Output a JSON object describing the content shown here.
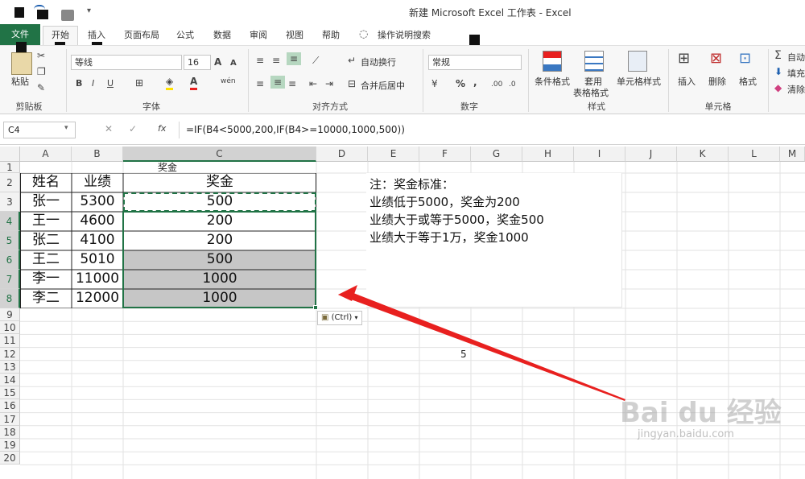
{
  "window": {
    "title": "新建 Microsoft Excel 工作表  -  Excel"
  },
  "tabs": [
    {
      "label": "文件"
    },
    {
      "label": "开始"
    },
    {
      "label": "插入"
    },
    {
      "label": "页面布局"
    },
    {
      "label": "公式"
    },
    {
      "label": "数据"
    },
    {
      "label": "审阅"
    },
    {
      "label": "视图"
    },
    {
      "label": "帮助"
    }
  ],
  "tell_me": {
    "label": "操作说明搜索"
  },
  "ribbon": {
    "clipboard": {
      "paste": "粘贴",
      "label": "剪贴板"
    },
    "font": {
      "name": "等线",
      "size": "16",
      "label": "字体",
      "bold": "B",
      "italic": "I",
      "underline": "U",
      "phonetic": "wén"
    },
    "align": {
      "wrap": "自动换行",
      "merge": "合并后居中",
      "label": "对齐方式"
    },
    "number": {
      "format": "常规",
      "label": "数字",
      "percent": "%",
      "comma": ","
    },
    "styles": {
      "conditional": "条件格式",
      "table_l1": "套用",
      "table_l2": "表格格式",
      "cell_styles": "单元格样式",
      "label": "样式"
    },
    "cells": {
      "insert": "插入",
      "delete": "删除",
      "format": "格式",
      "label": "单元格"
    },
    "editing": {
      "autosum": "自动",
      "fill": "填充",
      "clear": "清除"
    }
  },
  "formula_bar": {
    "name_box": "C4",
    "fx": "fx",
    "formula": "=IF(B4<5000,200,IF(B4>=10000,1000,500))"
  },
  "columns": [
    "A",
    "B",
    "C",
    "D",
    "E",
    "F",
    "G",
    "H",
    "I",
    "J",
    "K",
    "L",
    "M"
  ],
  "rows": [
    "1",
    "2",
    "3",
    "4",
    "5",
    "6",
    "7",
    "8",
    "9",
    "10",
    "11",
    "12",
    "13",
    "14",
    "15",
    "16",
    "17",
    "18",
    "19",
    "20"
  ],
  "table": {
    "merged_title": "奖金",
    "headers": [
      "姓名",
      "业绩",
      "奖金"
    ],
    "rows": [
      [
        "张一",
        "5300",
        "500"
      ],
      [
        "王一",
        "4600",
        "200"
      ],
      [
        "张二",
        "4100",
        "200"
      ],
      [
        "王二",
        "5010",
        "500"
      ],
      [
        "李一",
        "11000",
        "1000"
      ],
      [
        "李二",
        "12000",
        "1000"
      ]
    ]
  },
  "notes": [
    "注：奖金标准：",
    "业绩低于5000，奖金为200",
    "业绩大于或等于5000，奖金500",
    "业绩大于等于1万，奖金1000"
  ],
  "stray_value": "5",
  "paste_options": {
    "label": "(Ctrl)"
  },
  "watermark": {
    "brand": "Bai du 经验",
    "url": "jingyan.baidu.com"
  },
  "colors": {
    "excel_green": "#217346",
    "selection_fill": "#c6c6c6",
    "arrow_red": "#e8201f"
  }
}
